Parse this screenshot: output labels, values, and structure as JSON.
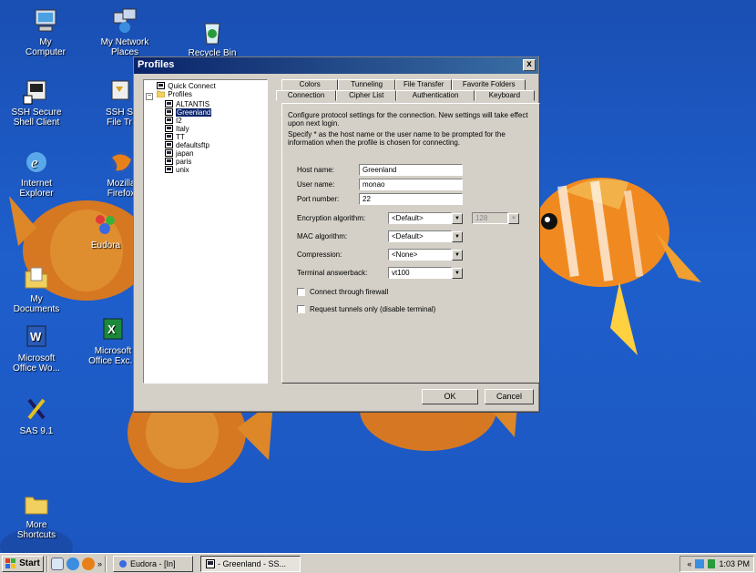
{
  "desktop": {
    "icons": [
      {
        "label": "My\nComputer",
        "icon": "my-computer-icon"
      },
      {
        "label": "My Network\nPlaces",
        "icon": "network-places-icon"
      },
      {
        "label": "Recycle Bin",
        "icon": "recycle-bin-icon"
      },
      {
        "label": "SSH Secure\nShell Client",
        "icon": "ssh-client-icon"
      },
      {
        "label": "SSH S\nFile Tr",
        "icon": "ssh-file-transfer-icon"
      },
      {
        "label": "Internet\nExplorer",
        "icon": "internet-explorer-icon"
      },
      {
        "label": "Mozilla\nFirefox",
        "icon": "firefox-icon"
      },
      {
        "label": "Eudora",
        "icon": "eudora-icon"
      },
      {
        "label": "My\nDocuments",
        "icon": "my-documents-icon"
      },
      {
        "label": "Microsoft\nOffice Wo...",
        "icon": "word-icon"
      },
      {
        "label": "Microsoft\nOffice Exc...",
        "icon": "excel-icon"
      },
      {
        "label": "SAS 9.1",
        "icon": "sas-icon"
      },
      {
        "label": "More\nShortcuts",
        "icon": "folder-icon"
      }
    ]
  },
  "dialog": {
    "title": "Profiles",
    "close": "x",
    "tree": {
      "quick_connect": "Quick Connect",
      "profiles": "Profiles",
      "items": [
        "ALTANTIS",
        "Greenland",
        "I2",
        "Italy",
        "TT",
        "defaultsftp",
        "japan",
        "paris",
        "unix"
      ],
      "selected": "Greenland"
    },
    "tabs_back": [
      "Colors",
      "Tunneling",
      "File Transfer",
      "Favorite Folders"
    ],
    "tabs_front": [
      "Connection",
      "Cipher List",
      "Authentication",
      "Keyboard"
    ],
    "active_tab": "Connection",
    "desc1": "Configure protocol settings for the connection. New settings will take effect upon next login.",
    "desc2": "Specify * as the host name or the user name to be prompted for the information when the profile is chosen for connecting.",
    "fields": {
      "host_label": "Host name:",
      "host_value": "Greenland",
      "user_label": "User name:",
      "user_value": "monao",
      "port_label": "Port number:",
      "port_value": "22"
    },
    "selects": {
      "enc_label": "Encryption algorithm:",
      "enc_value": "<Default>",
      "enc_bits": "128",
      "mac_label": "MAC algorithm:",
      "mac_value": "<Default>",
      "comp_label": "Compression:",
      "comp_value": "<None>",
      "term_label": "Terminal answerback:",
      "term_value": "vt100"
    },
    "checks": {
      "firewall": "Connect through firewall",
      "tunnels": "Request tunnels only (disable terminal)"
    },
    "ok": "OK",
    "cancel": "Cancel"
  },
  "taskbar": {
    "start": "Start",
    "chevron": "»",
    "tasks": [
      "Eudora - [In]",
      "- Greenland - SS..."
    ],
    "tray_chevron": "«",
    "clock": "1:03 PM"
  }
}
